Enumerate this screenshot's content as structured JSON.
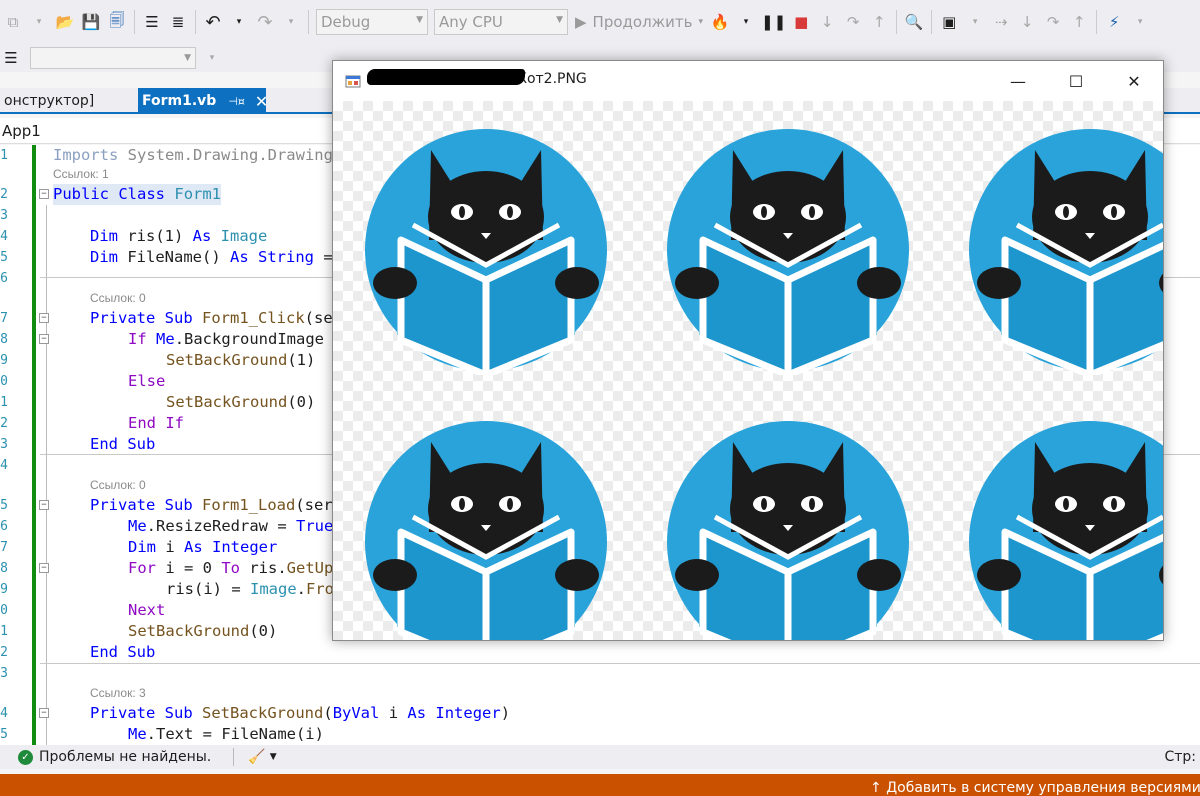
{
  "toolbar": {
    "config_combo": "Debug",
    "platform_combo": "Any CPU",
    "continue_label": "Продолжить"
  },
  "tabs": [
    {
      "label": "онструктор]"
    },
    {
      "label": "Form1.vb"
    }
  ],
  "navbar": {
    "project": "App1"
  },
  "code_lines": [
    {
      "num": "1",
      "text": "Imports System.Drawing.Drawing"
    },
    {
      "lens": "Ссылок: 1"
    },
    {
      "num": "2",
      "text": "Public Class Form1"
    },
    {
      "num": "3",
      "text": ""
    },
    {
      "num": "4",
      "text": "Dim ris(1) As Image"
    },
    {
      "num": "5",
      "text": "Dim FileName() As String ="
    },
    {
      "num": "6",
      "text": ""
    },
    {
      "lens": "Ссылок: 0"
    },
    {
      "num": "7",
      "text": "Private Sub Form1_Click(se"
    },
    {
      "num": "8",
      "text": "If Me.BackgroundImage"
    },
    {
      "num": "9",
      "text": "SetBackGround(1)"
    },
    {
      "num": "0",
      "text": "Else"
    },
    {
      "num": "1",
      "text": "SetBackGround(0)"
    },
    {
      "num": "2",
      "text": "End If"
    },
    {
      "num": "3",
      "text": "End Sub"
    },
    {
      "num": "4",
      "text": ""
    },
    {
      "lens": "Ссылок: 0"
    },
    {
      "num": "5",
      "text": "Private Sub Form1_Load(ser"
    },
    {
      "num": "6",
      "text": "Me.ResizeRedraw = True"
    },
    {
      "num": "7",
      "text": "Dim i As Integer"
    },
    {
      "num": "8",
      "text": "For i = 0 To ris.GetUp"
    },
    {
      "num": "9",
      "text": "ris(i) = Image.Fro"
    },
    {
      "num": "0",
      "text": "Next"
    },
    {
      "num": "1",
      "text": "SetBackGround(0)"
    },
    {
      "num": "2",
      "text": "End Sub"
    },
    {
      "num": "3",
      "text": ""
    },
    {
      "lens": "Ссылок: 3"
    },
    {
      "num": "4",
      "text": "Private Sub SetBackGround(ByVal i As Integer)"
    },
    {
      "num": "5",
      "text": "Me.Text = FileName(i)"
    }
  ],
  "status": {
    "problems": "Проблемы не найдены.",
    "position": "Стр:"
  },
  "bottom": {
    "vcs": "Добавить в систему управления версиями"
  },
  "app_window": {
    "title": "Кот2.PNG"
  },
  "colors": {
    "accent": "#0e70c0",
    "bottom_bar": "#ca5100",
    "circle": "#29a3d9",
    "cat": "#1b1b1b"
  },
  "icons": [
    "new-project-icon",
    "open-folder-icon",
    "save-icon",
    "save-all-icon",
    "undo-icon",
    "redo-icon",
    "play-icon",
    "hot-reload-icon",
    "pause-icon",
    "stop-icon",
    "step-icon"
  ]
}
